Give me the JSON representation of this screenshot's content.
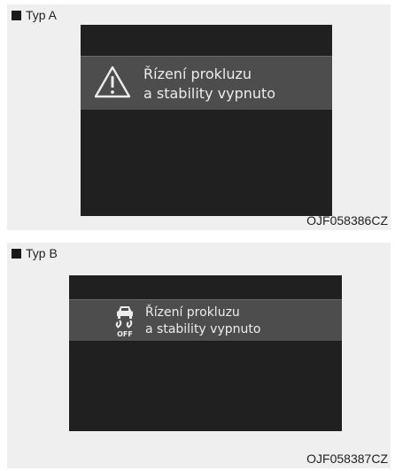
{
  "type_a": {
    "label": "Typ A",
    "message_line1": "Řízení prokluzu",
    "message_line2": "a stability vypnuto",
    "icon": "warning-triangle-icon",
    "code": "OJF058386CZ"
  },
  "type_b": {
    "label": "Typ B",
    "message_line1": "Řízení prokluzu",
    "message_line2": "a stability vypnuto",
    "icon": "esc-off-icon",
    "icon_text": "OFF",
    "code": "OJF058387CZ"
  }
}
